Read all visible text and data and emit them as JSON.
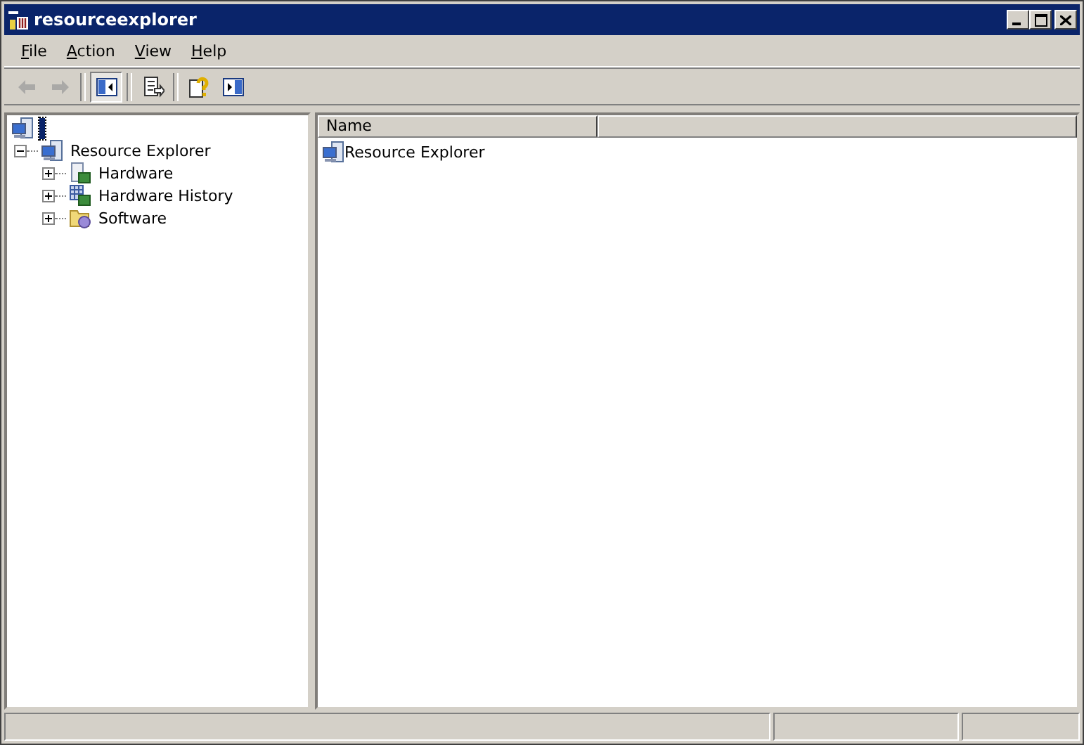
{
  "window": {
    "title": "resourceexplorer"
  },
  "menu": [
    "File",
    "Action",
    "View",
    "Help"
  ],
  "toolbar": [
    {
      "kind": "back",
      "disabled": true,
      "pressed": false
    },
    {
      "kind": "forward",
      "disabled": true,
      "pressed": false
    },
    {
      "kind": "tree",
      "disabled": false,
      "pressed": true
    },
    {
      "kind": "export",
      "disabled": false,
      "pressed": false
    },
    {
      "kind": "help",
      "disabled": false,
      "pressed": false
    },
    {
      "kind": "actionpane",
      "disabled": false,
      "pressed": false
    }
  ],
  "tree": {
    "selected": true,
    "children": [
      {
        "label": "Resource Explorer",
        "kind": "computer",
        "selected": false,
        "expanded": true,
        "children": [
          {
            "label": "Hardware",
            "kind": "hardware",
            "selected": false,
            "expanded": false
          },
          {
            "label": "Hardware History",
            "kind": "history",
            "selected": false,
            "expanded": false
          },
          {
            "label": "Software",
            "kind": "software",
            "selected": false,
            "expanded": false
          }
        ]
      }
    ]
  },
  "list": {
    "columns": [
      "Name"
    ],
    "rows": [
      {
        "name": "Resource Explorer",
        "kind": "computer"
      }
    ]
  }
}
